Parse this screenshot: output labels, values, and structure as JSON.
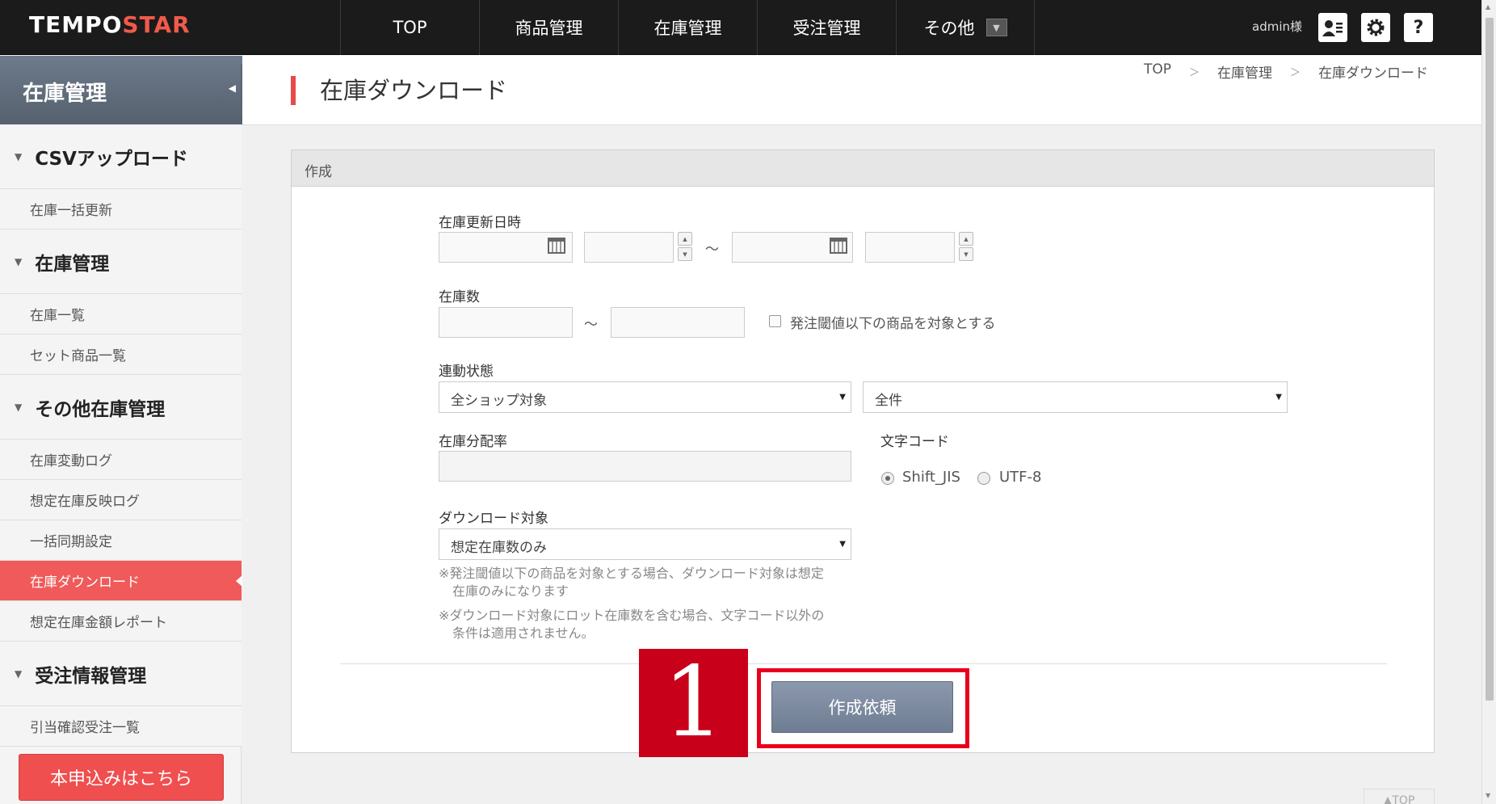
{
  "header": {
    "logo_main": "TEMPO",
    "logo_accent": "STAR",
    "nav": [
      "TOP",
      "商品管理",
      "在庫管理",
      "受注管理",
      "その他"
    ],
    "user": "admin様"
  },
  "sidebar": {
    "title": "在庫管理",
    "sections": [
      {
        "label": "CSVアップロード",
        "items": [
          "在庫一括更新"
        ]
      },
      {
        "label": "在庫管理",
        "items": [
          "在庫一覧",
          "セット商品一覧"
        ]
      },
      {
        "label": "その他在庫管理",
        "items": [
          "在庫変動ログ",
          "想定在庫反映ログ",
          "一括同期設定",
          "在庫ダウンロード",
          "想定在庫金額レポート"
        ]
      },
      {
        "label": "受注情報管理",
        "items": [
          "引当確認受注一覧"
        ]
      }
    ],
    "active_item": "在庫ダウンロード",
    "apply_button": "本申込みはこちら"
  },
  "page": {
    "title": "在庫ダウンロード",
    "breadcrumb": [
      "TOP",
      "在庫管理",
      "在庫ダウンロード"
    ],
    "breadcrumb_sep": "＞"
  },
  "form": {
    "panel_title": "作成",
    "update_datetime_label": "在庫更新日時",
    "range_sep": "～",
    "stock_count_label": "在庫数",
    "threshold_checkbox_label": "発注閾値以下の商品を対象とする",
    "link_status_label": "連動状態",
    "link_status_value": "全ショップ対象",
    "link_status_value2": "全件",
    "allocation_label": "在庫分配率",
    "charset_label": "文字コード",
    "charset_options": [
      "Shift_JIS",
      "UTF-8"
    ],
    "charset_selected": "Shift_JIS",
    "download_target_label": "ダウンロード対象",
    "download_target_value": "想定在庫数のみ",
    "notes": [
      "※発注閾値以下の商品を対象とする場合、ダウンロード対象は想定",
      "在庫のみになります",
      "※ダウンロード対象にロット在庫数を含む場合、文字コード以外の",
      "条件は適用されません。"
    ],
    "submit_button": "作成依頼"
  },
  "annotation": {
    "badge": "1"
  },
  "totop": "▲TOP",
  "colors": {
    "accent": "#f05a5a",
    "header": "#1b1b1b",
    "button": "#7d8aa0",
    "highlight": "#e8001c"
  }
}
